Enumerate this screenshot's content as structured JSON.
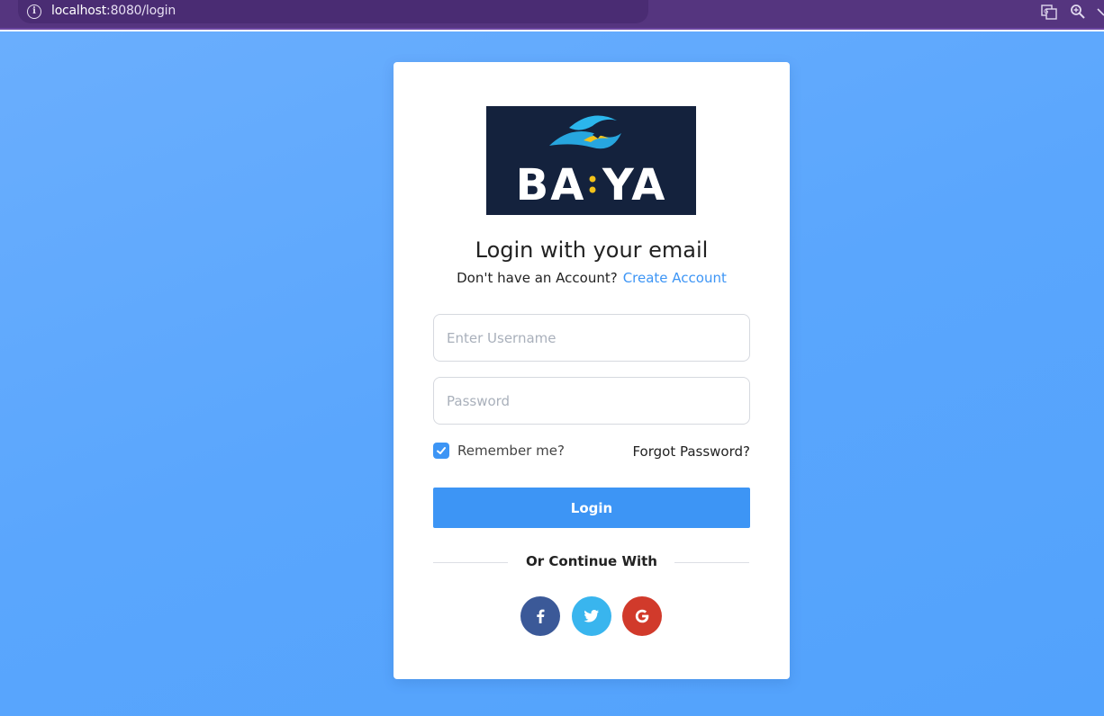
{
  "browser": {
    "url_host": "localhost",
    "url_path": ":8080/login"
  },
  "logo": {
    "text": "BA:YA"
  },
  "login": {
    "title": "Login with your email",
    "no_account_text": "Don't have an Account?",
    "create_account_label": "Create Account",
    "username_placeholder": "Enter Username",
    "password_placeholder": "Password",
    "remember_label": "Remember me?",
    "remember_checked": true,
    "forgot_label": "Forgot Password?",
    "login_button": "Login",
    "divider_text": "Or Continue With"
  },
  "social": [
    {
      "name": "facebook",
      "icon": "facebook-icon",
      "color": "#3b5998"
    },
    {
      "name": "twitter",
      "icon": "twitter-icon",
      "color": "#39b5ee"
    },
    {
      "name": "google",
      "icon": "google-icon",
      "color": "#d13a2b"
    }
  ],
  "colors": {
    "accent": "#3d95f5",
    "browser_bar": "#55357f",
    "logo_bg": "#14223d"
  }
}
